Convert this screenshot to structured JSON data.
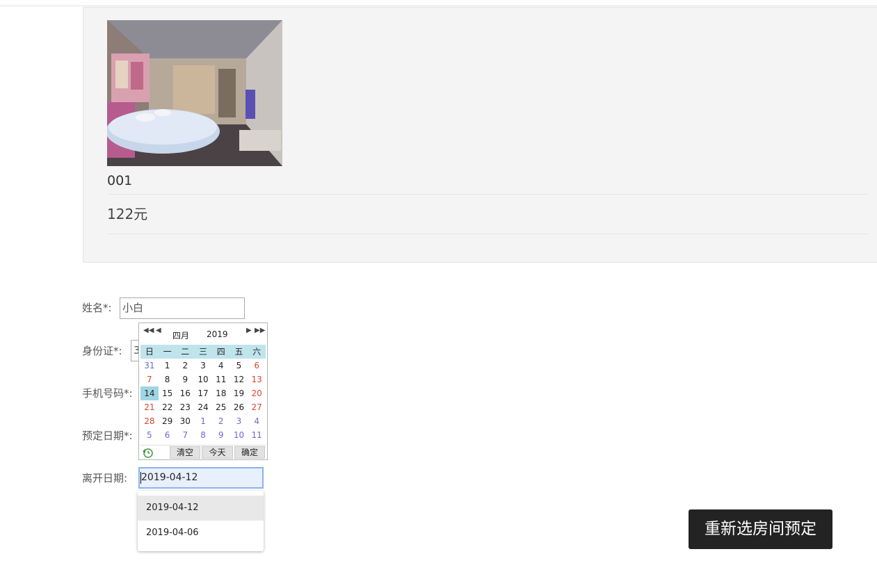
{
  "room": {
    "number": "001",
    "price": "122元"
  },
  "form": {
    "name_label": "姓名*:",
    "name_value": "小白",
    "id_label": "身份证*:",
    "id_value_partial": "3",
    "phone_label": "手机号码*:",
    "book_date_label": "预定日期*:",
    "leave_date_label": "离开日期:",
    "leave_date_value": "2019-04-12"
  },
  "calendar": {
    "month": "四月",
    "year": "2019",
    "weekdays": [
      "日",
      "一",
      "二",
      "三",
      "四",
      "五",
      "六"
    ],
    "weeks": [
      [
        "31",
        "1",
        "2",
        "3",
        "4",
        "5",
        "6"
      ],
      [
        "7",
        "8",
        "9",
        "10",
        "11",
        "12",
        "13"
      ],
      [
        "14",
        "15",
        "16",
        "17",
        "18",
        "19",
        "20"
      ],
      [
        "21",
        "22",
        "23",
        "24",
        "25",
        "26",
        "27"
      ],
      [
        "28",
        "29",
        "30",
        "1",
        "2",
        "3",
        "4"
      ],
      [
        "5",
        "6",
        "7",
        "8",
        "9",
        "10",
        "11"
      ]
    ],
    "today": "14",
    "clear_label": "清空",
    "today_label": "今天",
    "ok_label": "确定",
    "colors": {
      "weekend": "#d8452f",
      "other_month": "#6b6bd0",
      "header_bg": "#bfe4ec",
      "today_bg": "#9fd6e3"
    }
  },
  "autocomplete": {
    "options": [
      "2019-04-12",
      "2019-04-06"
    ]
  },
  "actions": {
    "rebook_label": "重新选房间预定"
  }
}
